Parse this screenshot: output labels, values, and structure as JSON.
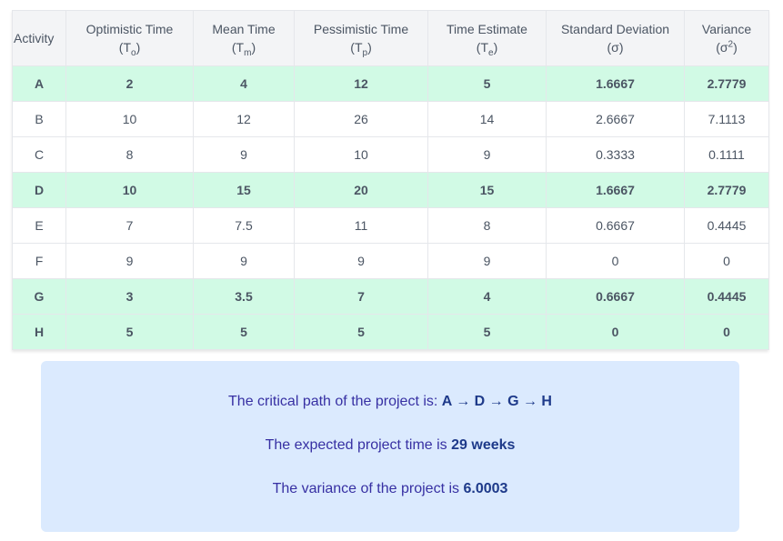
{
  "table": {
    "headers": [
      {
        "label": "Activity",
        "symbol_base": "",
        "symbol_mod": "",
        "mod_type": ""
      },
      {
        "label": "Optimistic Time",
        "symbol_base": "T",
        "symbol_mod": "o",
        "mod_type": "sub"
      },
      {
        "label": "Mean Time",
        "symbol_base": "T",
        "symbol_mod": "m",
        "mod_type": "sub"
      },
      {
        "label": "Pessimistic Time",
        "symbol_base": "T",
        "symbol_mod": "p",
        "mod_type": "sub"
      },
      {
        "label": "Time Estimate",
        "symbol_base": "T",
        "symbol_mod": "e",
        "mod_type": "sub"
      },
      {
        "label": "Standard Deviation",
        "symbol_base": "σ",
        "symbol_mod": "",
        "mod_type": ""
      },
      {
        "label": "Variance",
        "symbol_base": "σ",
        "symbol_mod": "2",
        "mod_type": "sup"
      }
    ],
    "rows": [
      {
        "critical": true,
        "cells": [
          "A",
          "2",
          "4",
          "12",
          "5",
          "1.6667",
          "2.7779"
        ]
      },
      {
        "critical": false,
        "cells": [
          "B",
          "10",
          "12",
          "26",
          "14",
          "2.6667",
          "7.1113"
        ]
      },
      {
        "critical": false,
        "cells": [
          "C",
          "8",
          "9",
          "10",
          "9",
          "0.3333",
          "0.1111"
        ]
      },
      {
        "critical": true,
        "cells": [
          "D",
          "10",
          "15",
          "20",
          "15",
          "1.6667",
          "2.7779"
        ]
      },
      {
        "critical": false,
        "cells": [
          "E",
          "7",
          "7.5",
          "11",
          "8",
          "0.6667",
          "0.4445"
        ]
      },
      {
        "critical": false,
        "cells": [
          "F",
          "9",
          "9",
          "9",
          "9",
          "0",
          "0"
        ]
      },
      {
        "critical": true,
        "cells": [
          "G",
          "3",
          "3.5",
          "7",
          "4",
          "0.6667",
          "0.4445"
        ]
      },
      {
        "critical": true,
        "cells": [
          "H",
          "5",
          "5",
          "5",
          "5",
          "0",
          "0"
        ]
      }
    ]
  },
  "summary": {
    "critical_path_text": "The critical path of the project is: ",
    "critical_path_value": "A → D → G → H",
    "expected_time_text": "The expected project time is ",
    "expected_time_value": "29 weeks",
    "variance_text": "The variance of the project is ",
    "variance_value": "6.0003"
  },
  "colors": {
    "critical_row_bg": "#d1fae5",
    "header_bg": "#f3f4f6",
    "summary_bg": "#dbeafe",
    "summary_text": "#3730a3"
  }
}
